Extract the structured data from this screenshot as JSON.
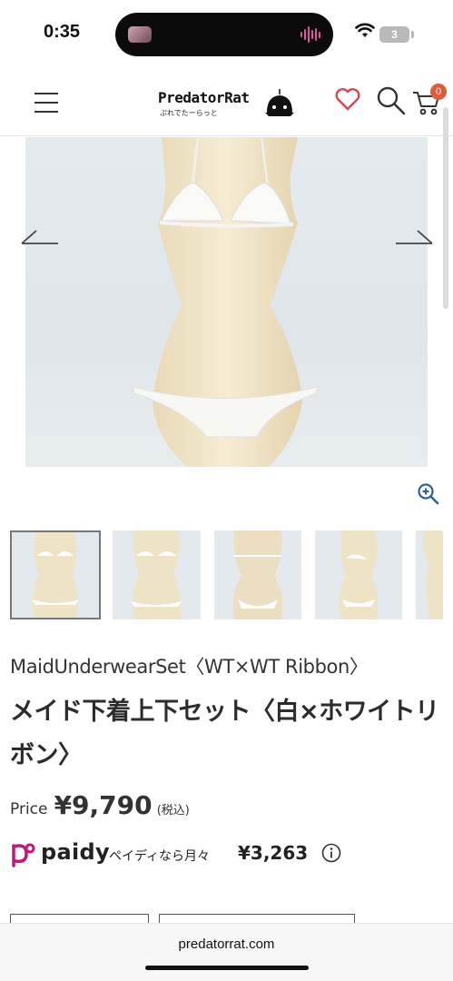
{
  "status_bar": {
    "time": "0:35",
    "battery": "3"
  },
  "header": {
    "logo_text": "PredatorRat",
    "logo_sub": "ぷれでたーらっと",
    "cart_count": "0",
    "icons": [
      "menu-icon",
      "heart-icon",
      "search-icon",
      "cart-icon"
    ],
    "heart_color": "#d8464f"
  },
  "gallery": {
    "prev_icon": "arrow-left-icon",
    "next_icon": "arrow-right-icon",
    "zoom_icon": "zoom-in-icon",
    "thumbnails": [
      "front",
      "front-angle",
      "back",
      "side",
      "detail"
    ],
    "active_thumbnail": 0
  },
  "product": {
    "title_en": "MaidUnderwearSet〈WT×WT Ribbon〉",
    "title_jp": "メイド下着上下セット〈白×ホワイトリボン〉",
    "price_label": "Price",
    "price": "¥9,790",
    "price_tax": "(税込)"
  },
  "paidy": {
    "logo": "paidy",
    "text": "ペイディなら月々",
    "amount": "¥3,263",
    "accent_color": "#c3177f"
  },
  "browser": {
    "url": "predatorrat.com"
  }
}
